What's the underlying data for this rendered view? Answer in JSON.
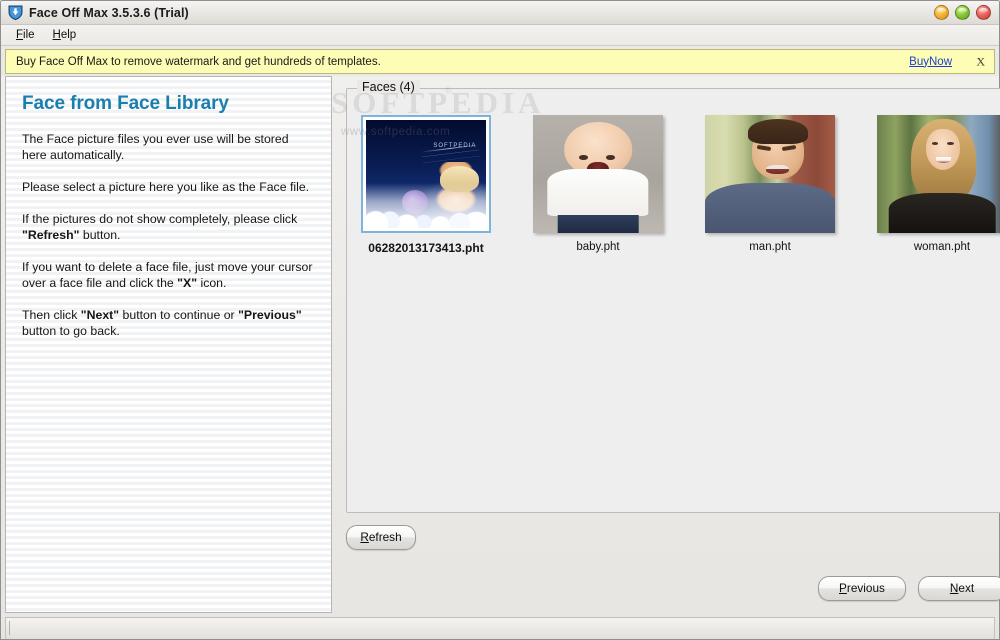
{
  "window": {
    "title": "Face Off Max  3.5.3.6  (Trial)",
    "icon": "app-shield-arrow-icon",
    "buttons": [
      {
        "name": "minimize",
        "color": "#f2b63a"
      },
      {
        "name": "maximize",
        "color": "#8cc83c"
      },
      {
        "name": "close",
        "color": "#e8665c"
      }
    ]
  },
  "menubar": {
    "items": [
      {
        "label": "File",
        "accel": "F"
      },
      {
        "label": "Help",
        "accel": "H"
      }
    ]
  },
  "banner": {
    "text": "Buy Face Off Max to remove watermark and get hundreds of templates.",
    "link_label": "BuyNow",
    "close_label": "X",
    "background": "#fdfdb5",
    "link_color": "#1a3fd0"
  },
  "sidebar": {
    "title": "Face from Face Library",
    "title_color": "#1a7fae",
    "paragraphs": [
      "The Face picture files you ever use will be stored here automatically.",
      "Please select a picture here you like as the Face file.",
      "If the pictures do not show completely, please click \"Refresh\" button.",
      "If you want to delete a face file, just move your cursor over a face file and click the \"X\" icon.",
      "Then click \"Next\" button to continue or \"Previous\" button to go back."
    ]
  },
  "main": {
    "group_legend": "Faces (4)",
    "faces": [
      {
        "label": "06282013173413.pht",
        "art": "art-poster",
        "selected": true
      },
      {
        "label": "baby.pht",
        "art": "art-baby",
        "selected": false
      },
      {
        "label": "man.pht",
        "art": "art-man",
        "selected": false
      },
      {
        "label": "woman.pht",
        "art": "art-woman",
        "selected": false
      }
    ],
    "refresh_label": "Refresh",
    "previous_label": "Previous",
    "next_label": "Next",
    "selection_border_color": "#7cb4dc"
  },
  "watermark": {
    "big": "SOFTPEDIA",
    "small": "www.softpedia.com",
    "tm": "®"
  }
}
